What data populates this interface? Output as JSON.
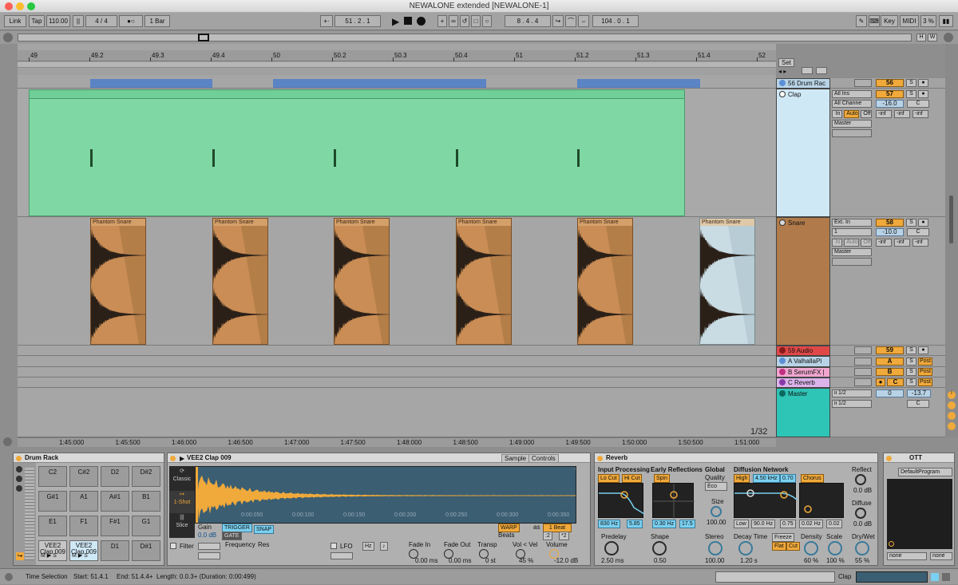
{
  "window": {
    "title": "NEWALONE extended  [NEWALONE-1]"
  },
  "control_bar": {
    "link": "Link",
    "tap": "Tap",
    "tempo": "110.00",
    "signature": "4 / 4",
    "metronome": "●○",
    "quantize": "1 Bar",
    "position": "51 .  2 .  1",
    "loop_start": "8 .  4 .  4",
    "loop_length": "104 .  0 .  1",
    "key": "Key",
    "midi": "MIDI",
    "cpu": "3 %",
    "d": "D",
    "hw_h": "H",
    "hw_w": "W"
  },
  "ruler": {
    "bars": [
      "49",
      "49.2",
      "49.3",
      "49.4",
      "50",
      "50.2",
      "50.3",
      "50.4",
      "51",
      "51.2",
      "51.3",
      "51.4",
      "52"
    ],
    "set_label": "Set"
  },
  "time_ruler": {
    "labels": [
      "1:45:000",
      "1:45:500",
      "1:46:000",
      "1:46:500",
      "1:47:000",
      "1:47:500",
      "1:48:000",
      "1:48:500",
      "1:49:000",
      "1:49:500",
      "1:50:000",
      "1:50:500",
      "1:51:000"
    ],
    "zoom": "1/32"
  },
  "tracks": {
    "drum_rack": {
      "name": "56 Drum Rac",
      "number": "56",
      "s": "S"
    },
    "clap": {
      "name": "Clap",
      "input": "All Ins",
      "channel": "All Channe",
      "in": "In",
      "auto": "Auto",
      "off": "Off",
      "output": "Master",
      "number": "57",
      "volume": "-16.0",
      "pan": "C",
      "send1": "-inf",
      "send2": "-inf",
      "send3": "-inf",
      "s": "S"
    },
    "snare": {
      "name": "Snare",
      "input": "Ext. In",
      "channel": "1",
      "in": "In",
      "auto": "Auto",
      "off": "Off",
      "output": "Master",
      "number": "58",
      "volume": "-10.0",
      "pan": "C",
      "send1": "-inf",
      "send2": "-inf",
      "send3": "-inf",
      "s": "S",
      "clip_name": "Phantom Snare"
    },
    "audio59": {
      "name": "59 Audio",
      "number": "59",
      "s": "S"
    },
    "return_a": {
      "name": "A ValhallaPl",
      "letter": "A",
      "s": "S",
      "post": "Post"
    },
    "return_b": {
      "name": "B SerumFX |",
      "letter": "B",
      "s": "S",
      "post": "Post"
    },
    "return_c": {
      "name": "C Reverb",
      "letter": "C",
      "s": "S",
      "post": "Post"
    },
    "master": {
      "name": "Master",
      "cue": "ii 1/2",
      "out": "ii 1/2",
      "number": "0",
      "volume": "-13.7",
      "pan": "C"
    }
  },
  "drum_rack": {
    "title": "Drum Rack",
    "pads": [
      "C2",
      "C#2",
      "D2",
      "D#2",
      "G#1",
      "A1",
      "A#1",
      "B1",
      "E1",
      "F1",
      "F#1",
      "G1",
      "VEE2 Clap 009",
      "VEE2 Clap 009",
      "D1",
      "D#1"
    ],
    "m": "M",
    "s": "S"
  },
  "simpler": {
    "title": "VEE2 Clap 009",
    "tab_sample": "Sample",
    "tab_controls": "Controls",
    "modes": [
      "Classic",
      "1-Shot",
      "Slice"
    ],
    "gain_label": "Gain",
    "gain": "0.0 dB",
    "trigger": "TRIGGER",
    "gate": "GATE",
    "snap": "SNAP",
    "warp": "WARP",
    "as": "as",
    "beats": "1 Beat",
    "beats_mode": "Beats",
    "div": ":2",
    "mul": "*2",
    "wave_ticks": [
      "0:00:050",
      "0:00:100",
      "0:00:150",
      "0:00:200",
      "0:00:250",
      "0:00:300",
      "0:00:350"
    ],
    "filter": "Filter",
    "frequency": "Frequency",
    "res": "Res",
    "lfo": "LFO",
    "hz": "Hz",
    "note": "♪",
    "fade_in_label": "Fade In",
    "fade_in": "0.00 ms",
    "fade_out_label": "Fade Out",
    "fade_out": "0.00 ms",
    "transp_label": "Transp",
    "transp": "0 st",
    "vel_label": "Vol < Vel",
    "vel": "45 %",
    "volume_label": "Volume",
    "volume": "-12.0 dB"
  },
  "reverb": {
    "title": "Reverb",
    "input_processing": "Input Processing",
    "lo_cut": "Lo Cut",
    "hi_cut": "Hi Cut",
    "freq": "830 Hz",
    "width": "5.85",
    "early_reflections": "Early Reflections",
    "spin": "Spin",
    "spin_rate": "0.30 Hz",
    "spin_amount": "17.5",
    "global": "Global",
    "quality": "Quality",
    "eco": "Eco",
    "size_label": "Size",
    "size": "100.00",
    "diffusion_network": "Diffusion Network",
    "high": "High",
    "high_freq": "4.50 kHz",
    "high_val": "0.70",
    "chorus": "Chorus",
    "low": "Low",
    "low_freq": "90.0 Hz",
    "low_val": "0.75",
    "chorus_rate": "0.02 Hz",
    "chorus_amt": "0.02",
    "reflect_label": "Reflect",
    "reflect": "0.0 dB",
    "diffuse_label": "Diffuse",
    "diffuse": "0.0 dB",
    "predelay_label": "Predelay",
    "predelay": "2.50 ms",
    "shape_label": "Shape",
    "shape": "0.50",
    "stereo_label": "Stereo",
    "stereo": "100.00",
    "decay_label": "Decay Time",
    "decay": "1.20 s",
    "freeze": "Freeze",
    "flat": "Flat",
    "cut": "Cut",
    "density_label": "Density",
    "density": "60 %",
    "scale_label": "Scale",
    "scale": "100 %",
    "drywet_label": "Dry/Wet",
    "drywet": "55 %"
  },
  "ott": {
    "title": "OTT",
    "preset": "DefaultProgram",
    "none1": "none",
    "none2": "none"
  },
  "status": {
    "time_selection": "Time Selection",
    "start": "Start: 51.4.1",
    "end": "End: 51.4.4+",
    "length": "Length: 0.0.3+ (Duration: 0:00:499)",
    "track": "Clap"
  },
  "colors": {
    "accent": "#f0a93b",
    "clap": "#6fcf97",
    "snare": "#b07a4a",
    "master": "#2ec4b6",
    "audio59": "#e04848",
    "return_a": "#5b8fd6",
    "return_b": "#e0509a",
    "return_c": "#c77ddb"
  }
}
